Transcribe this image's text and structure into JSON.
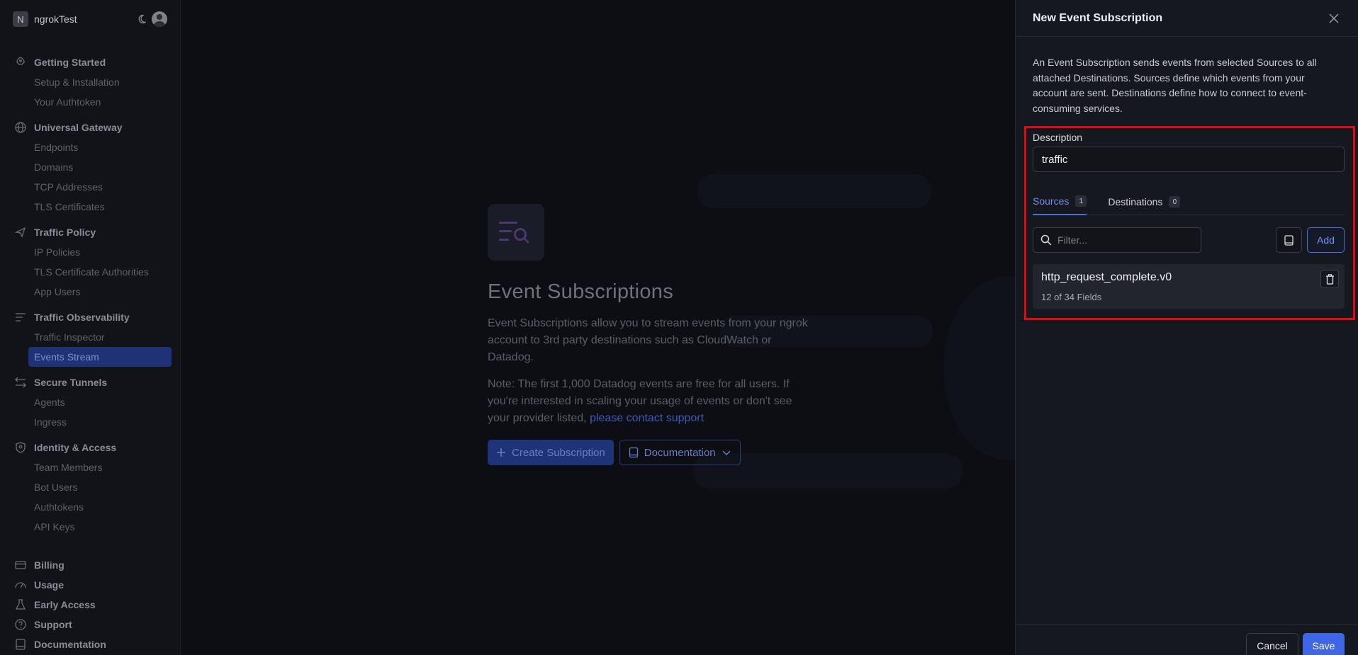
{
  "sidebar": {
    "org_initial": "N",
    "org_name": "ngrokTest",
    "groups": [
      {
        "title": "Getting Started",
        "icon": "rocket-icon",
        "items": [
          "Setup & Installation",
          "Your Authtoken"
        ]
      },
      {
        "title": "Universal Gateway",
        "icon": "globe-icon",
        "items": [
          "Endpoints",
          "Domains",
          "TCP Addresses",
          "TLS Certificates"
        ]
      },
      {
        "title": "Traffic Policy",
        "icon": "policy-icon",
        "items": [
          "IP Policies",
          "TLS Certificate Authorities",
          "App Users"
        ]
      },
      {
        "title": "Traffic Observability",
        "icon": "list-icon",
        "items": [
          "Traffic Inspector",
          "Events Stream"
        ]
      },
      {
        "title": "Secure Tunnels",
        "icon": "arrows-icon",
        "items": [
          "Agents",
          "Ingress"
        ]
      },
      {
        "title": "Identity & Access",
        "icon": "shield-icon",
        "items": [
          "Team Members",
          "Bot Users",
          "Authtokens",
          "API Keys"
        ]
      }
    ],
    "active_item": "Events Stream",
    "bottom": [
      {
        "title": "Billing",
        "icon": "card-icon"
      },
      {
        "title": "Usage",
        "icon": "gauge-icon"
      },
      {
        "title": "Early Access",
        "icon": "flask-icon"
      },
      {
        "title": "Support",
        "icon": "help-icon"
      },
      {
        "title": "Documentation",
        "icon": "book-icon"
      }
    ]
  },
  "main": {
    "title": "Event Subscriptions",
    "description": "Event Subscriptions allow you to stream events from your ngrok account to 3rd party destinations such as CloudWatch or Datadog.",
    "note_prefix": "Note: The first 1,000 Datadog events are free for all users. If you're interested in scaling your usage of events or don't see your provider listed,",
    "note_link": "please contact support",
    "create_label": "Create Subscription",
    "docs_label": "Documentation"
  },
  "panel": {
    "title": "New Event Subscription",
    "description": "An Event Subscription sends events from selected Sources to all attached Destinations. Sources define which events from your account are sent. Destinations define how to connect to event-consuming services.",
    "description_label": "Description",
    "description_value": "traffic",
    "tabs": [
      {
        "label": "Sources",
        "count": "1"
      },
      {
        "label": "Destinations",
        "count": "0"
      }
    ],
    "filter_placeholder": "Filter...",
    "add_label": "Add",
    "source": {
      "name": "http_request_complete.v0",
      "fields": "12 of 34 Fields"
    },
    "cancel_label": "Cancel",
    "save_label": "Save"
  },
  "colors": {
    "accent": "#3f66e6",
    "highlight": "#e00b13",
    "active_nav": "#1f3276"
  }
}
